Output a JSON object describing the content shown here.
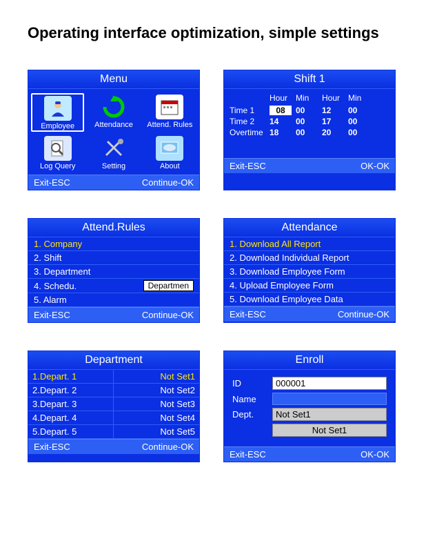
{
  "page_title": "Operating interface optimization, simple settings",
  "panels": {
    "menu": {
      "title": "Menu",
      "items": [
        "Employee",
        "Attendance",
        "Attend. Rules",
        "Log Query",
        "Setting",
        "About"
      ],
      "footer_left": "Exit-ESC",
      "footer_right": "Continue-OK"
    },
    "shift": {
      "title": "Shift 1",
      "headers": [
        "",
        "Hour",
        "Min",
        "Hour",
        "Min"
      ],
      "rows": [
        {
          "label": "Time 1",
          "values": [
            "08",
            "00",
            "12",
            "00"
          ],
          "active_index": 0
        },
        {
          "label": "Time 2",
          "values": [
            "14",
            "00",
            "17",
            "00"
          ]
        },
        {
          "label": "Overtime",
          "values": [
            "18",
            "00",
            "20",
            "00"
          ]
        }
      ],
      "footer_left": "Exit-ESC",
      "footer_right": "OK-OK"
    },
    "rules": {
      "title": "Attend.Rules",
      "items": [
        {
          "text": "1. Company",
          "selected": true
        },
        {
          "text": "2. Shift"
        },
        {
          "text": "3. Department"
        },
        {
          "text": "4. Schedu.",
          "suffix": "Departmen"
        },
        {
          "text": "5. Alarm"
        }
      ],
      "footer_left": "Exit-ESC",
      "footer_right": "Continue-OK"
    },
    "attendance": {
      "title": "Attendance",
      "items": [
        {
          "text": "1. Download All Report",
          "selected": true
        },
        {
          "text": "2. Download Individual Report"
        },
        {
          "text": "3. Download Employee Form"
        },
        {
          "text": "4. Upload Employee Form"
        },
        {
          "text": "5. Download Employee Data"
        }
      ],
      "footer_left": "Exit-ESC",
      "footer_right": "Continue-OK"
    },
    "department": {
      "title": "Department",
      "rows": [
        {
          "name": "1.Depart. 1",
          "value": "Not Set1",
          "selected": true
        },
        {
          "name": "2.Depart. 2",
          "value": "Not Set2"
        },
        {
          "name": "3.Depart. 3",
          "value": "Not Set3"
        },
        {
          "name": "4.Depart. 4",
          "value": "Not Set4"
        },
        {
          "name": "5.Depart. 5",
          "value": "Not Set5"
        }
      ],
      "footer_left": "Exit-ESC",
      "footer_right": "Continue-OK"
    },
    "enroll": {
      "title": "Enroll",
      "id_label": "ID",
      "id_value": "000001",
      "name_label": "Name",
      "name_value": "",
      "dept_label": "Dept.",
      "dept_value": "Not Set1",
      "extra_value": "Not Set1",
      "footer_left": "Exit-ESC",
      "footer_right": "OK-OK"
    }
  }
}
